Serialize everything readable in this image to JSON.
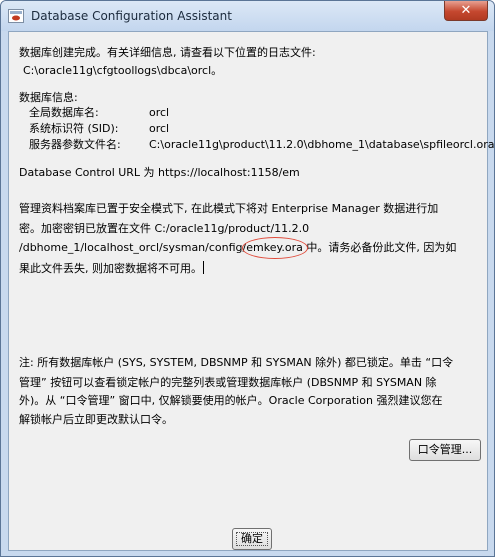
{
  "window": {
    "title": "Database Configuration Assistant",
    "close_label": "✕",
    "app_icon": "dbca-app-icon"
  },
  "body": {
    "intro_line1": "数据库创建完成。有关详细信息, 请查看以下位置的日志文件:",
    "intro_path": "C:\\oracle11g\\cfgtoollogs\\dbca\\orcl。",
    "db_info_header": "数据库信息:",
    "db_info": [
      {
        "label": "全局数据库名:",
        "value": "orcl"
      },
      {
        "label": "系统标识符 (SID):",
        "value": "orcl"
      },
      {
        "label": "服务器参数文件名:",
        "value": "C:\\oracle11g\\product\\11.2.0\\dbhome_1\\database\\spfileorcl.ora"
      }
    ],
    "dbcontrol_line": "Database Control URL 为 https://localhost:1158/em",
    "em_para_line1": "管理资料档案库已置于安全模式下, 在此模式下将对 Enterprise Manager 数据进行加",
    "em_para_line2": "密。加密密钥已放置在文件 C:/oracle11g/product/11.2.0",
    "em_para_line3_pre": "/dbhome_1/localhost_orcl/sysman/config/",
    "em_para_line3_key": "emkey.ora",
    "em_para_line3_post": " 中。请务必备份此文件, 因为如",
    "em_para_line4": "果此文件丢失, 则加密数据将不可用。",
    "note_line1": "注: 所有数据库帐户 (SYS, SYSTEM, DBSNMP 和 SYSMAN 除外) 都已锁定。单击 “口令",
    "note_line2": "管理” 按钮可以查看锁定帐户的完整列表或管理数据库帐户 (DBSNMP 和 SYSMAN 除",
    "note_line3": "外)。从 “口令管理” 窗口中, 仅解锁要使用的帐户。Oracle Corporation 强烈建议您在",
    "note_line4": "解锁帐户后立即更改默认口令。"
  },
  "buttons": {
    "password_mgmt": "口令管理...",
    "ok": "确定"
  }
}
